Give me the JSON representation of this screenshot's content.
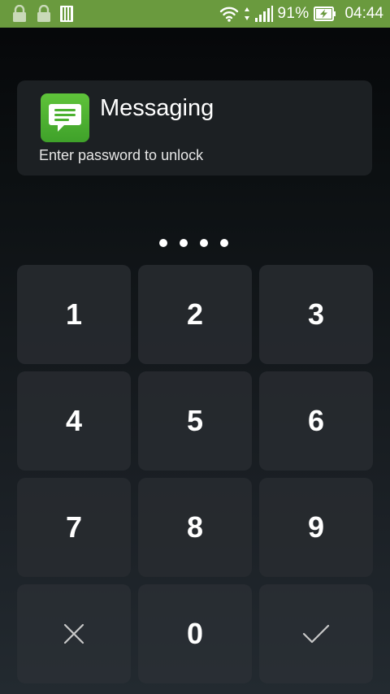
{
  "status_bar": {
    "battery": "91%",
    "time": "04:44",
    "icons": [
      "lock-icon",
      "lock-icon",
      "sim-card-icon",
      "wifi-icon",
      "data-transfer-icon",
      "signal-icon",
      "battery-charging-icon"
    ],
    "accent_color": "#6a9a3e"
  },
  "app_card": {
    "title": "Messaging",
    "subtitle": "Enter password to unlock",
    "icon": "messaging-icon",
    "icon_color": "#4cb130"
  },
  "pin": {
    "entered_count": 4
  },
  "keypad": {
    "keys": [
      "1",
      "2",
      "3",
      "4",
      "5",
      "6",
      "7",
      "8",
      "9",
      "",
      "0",
      ""
    ],
    "clear_icon": "close-icon",
    "confirm_icon": "checkmark-icon"
  }
}
